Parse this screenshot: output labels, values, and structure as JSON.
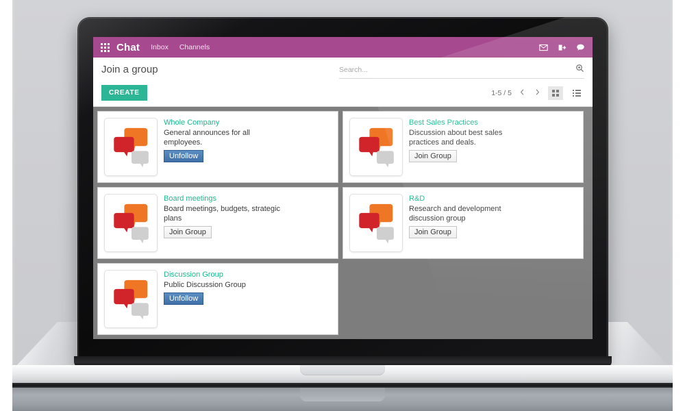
{
  "app": {
    "brand": "Chat",
    "apps_icon": "apps-grid-icon",
    "nav": [
      {
        "label": "Inbox",
        "name": "nav-inbox"
      },
      {
        "label": "Channels",
        "name": "nav-channels"
      }
    ],
    "topbar_icons": [
      {
        "name": "mail-icon"
      },
      {
        "name": "sign-in-icon"
      },
      {
        "name": "chat-bubble-icon"
      }
    ],
    "accent_purple": "#a7498f",
    "accent_teal": "#2cb696",
    "title_green": "#1aba8f"
  },
  "control": {
    "page_title": "Join a group",
    "create_label": "CREATE",
    "search_placeholder": "Search...",
    "search_value": "",
    "search_icon": "magnifier-plus-icon",
    "pager_count": "1-5 / 5",
    "prev_icon": "chevron-left-icon",
    "next_icon": "chevron-right-icon",
    "view_grid": "grid-view-icon",
    "view_list": "list-view-icon",
    "active_view": "grid"
  },
  "cards": [
    {
      "title": "Whole Company",
      "description": "General announces for all employees.",
      "button": "Unfollow",
      "button_type": "unfollow",
      "thumb": "speech-bubbles-icon"
    },
    {
      "title": "Best Sales Practices",
      "description": "Discussion about best sales practices and deals.",
      "button": "Join Group",
      "button_type": "join",
      "thumb": "speech-bubbles-icon"
    },
    {
      "title": "Board meetings",
      "description": "Board meetings, budgets, strategic plans",
      "button": "Join Group",
      "button_type": "join",
      "thumb": "speech-bubbles-icon"
    },
    {
      "title": "R&D",
      "description": "Research and development discussion group",
      "button": "Join Group",
      "button_type": "join",
      "thumb": "speech-bubbles-icon"
    },
    {
      "title": "Discussion Group",
      "description": "Public Discussion Group",
      "button": "Unfollow",
      "button_type": "unfollow",
      "thumb": "speech-bubbles-icon"
    }
  ]
}
